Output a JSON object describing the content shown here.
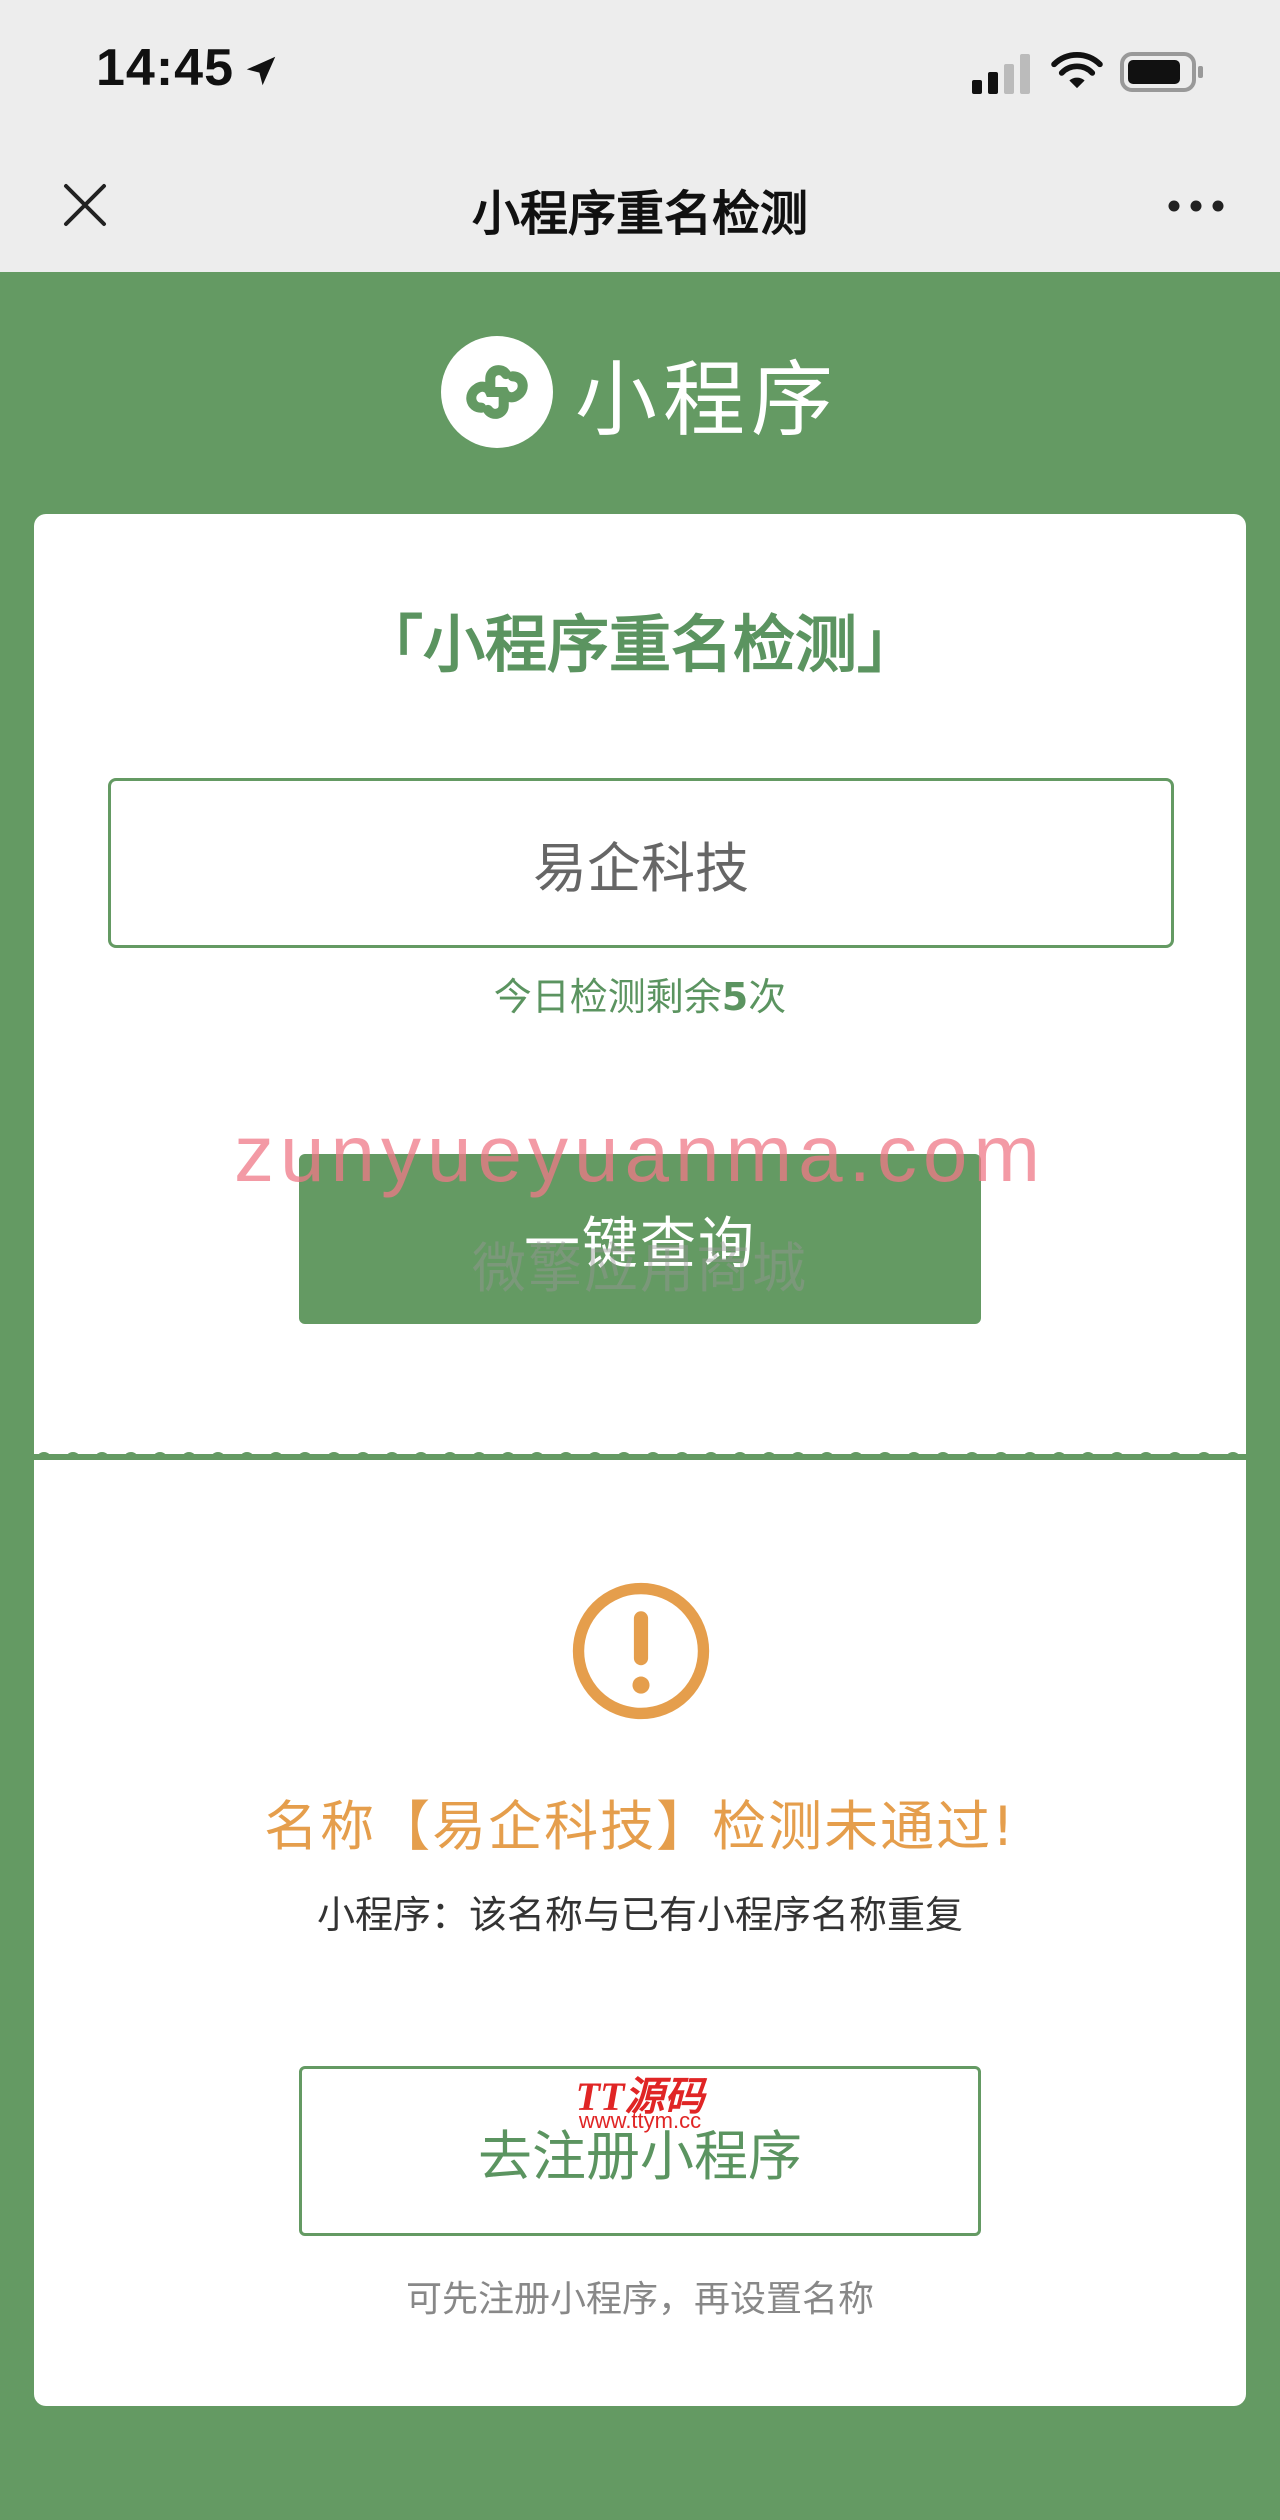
{
  "status_bar": {
    "time": "14:45"
  },
  "nav_bar": {
    "title": "小程序重名检测"
  },
  "brand": {
    "name": "小程序"
  },
  "query_card": {
    "title": "「小程序重名检测」",
    "input_value": "易企科技",
    "remaining_prefix": "今日检测剩余",
    "remaining_count": "5",
    "remaining_suffix": "次",
    "query_button": "一键查询"
  },
  "result_card": {
    "result_title": "名称【易企科技】检测未通过!",
    "result_reason": "小程序：该名称与已有小程序名称重复",
    "register_button": "去注册小程序",
    "register_hint": "可先注册小程序，再设置名称"
  },
  "watermarks": {
    "site_text": "zunyueyuanma.com",
    "shop_text": "微擎应用商城",
    "logo_text": "TT源码",
    "logo_url": "www.ttym.cc"
  },
  "colors": {
    "brand_green": "#649a63",
    "warning_orange": "#e59e4c"
  },
  "icons": {
    "close": "close-icon",
    "more": "more-icon",
    "logo": "mini-program-logo-icon",
    "warning": "warning-icon"
  }
}
